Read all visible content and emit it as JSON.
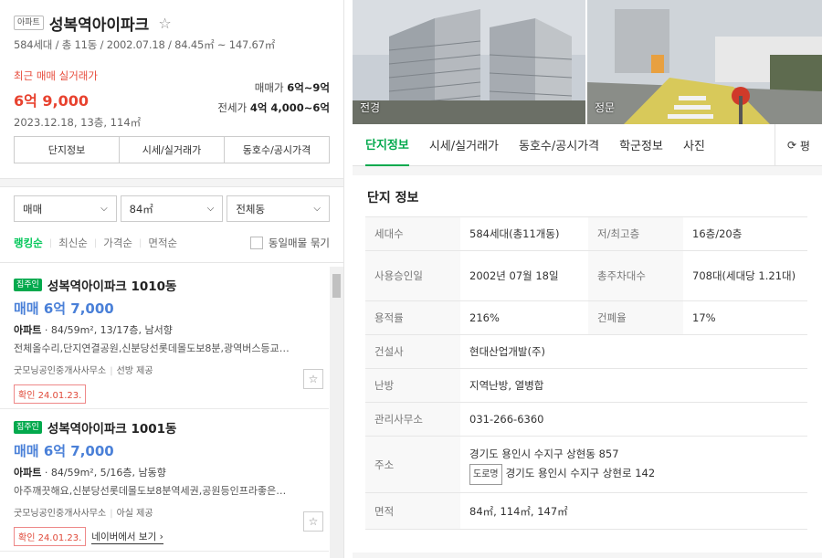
{
  "complex": {
    "type_badge": "아파트",
    "name": "성복역아이파크",
    "meta": "584세대 / 총 11동 / 2002.07.18 / 84.45㎡ ~ 147.67㎡",
    "recent_label": "최근 매매 실거래가",
    "recent_price": "6억 9,000",
    "recent_date": "2023.12.18, 13층, 114㎡",
    "sale_label": "매매가",
    "sale_range": "6억~9억",
    "jeonse_label": "전세가",
    "jeonse_range": "4억 4,000~6억"
  },
  "buttons": {
    "info": "단지정보",
    "price": "시세/실거래가",
    "unit": "동호수/공시가격"
  },
  "filters": {
    "trade": "매매",
    "area": "84㎡",
    "dong": "전체동"
  },
  "sort": {
    "ranking": "랭킹순",
    "latest": "최신순",
    "price": "가격순",
    "area": "면적순",
    "bundle": "동일매물 묶기"
  },
  "listings": [
    {
      "owner": "집주인",
      "name": "성복역아이파크 1010동",
      "price": "매매 6억 7,000",
      "kind": "아파트",
      "spec": " · 84/59m², 13/17층, 남서향",
      "features": "전체올수리,단지연결공원,신분당선롯데몰도보8분,광역버스등교…",
      "agent": "굿모닝공인중개사사무소",
      "provider": "선방 제공",
      "confirm": "확인 24.01.23.",
      "naver": ""
    },
    {
      "owner": "집주인",
      "name": "성복역아이파크 1001동",
      "price": "매매 6억 7,000",
      "kind": "아파트",
      "spec": " · 84/59m², 5/16층, 남동향",
      "features": "아주깨끗해요,신분당선롯데몰도보8분역세권,공원등인프라좋은…",
      "agent": "굿모닝공인중개사사무소",
      "provider": "아실 제공",
      "confirm": "확인 24.01.23.",
      "naver": "네이버에서 보기 ›"
    }
  ],
  "photos": {
    "left_caption": "전경",
    "right_caption": "정문"
  },
  "tabs": [
    "단지정보",
    "시세/실거래가",
    "동호수/공시가격",
    "학군정보",
    "사진"
  ],
  "tab_more": "평",
  "info": {
    "title": "단지 정보",
    "households_k": "세대수",
    "households_v": "584세대(총11개동)",
    "floors_k": "저/최고층",
    "floors_v": "16층/20층",
    "approval_k": "사용승인일",
    "approval_v": "2002년 07월 18일",
    "parking_k": "총주차대수",
    "parking_v": "708대(세대당 1.21대)",
    "far_k": "용적률",
    "far_v": "216%",
    "bcr_k": "건폐율",
    "bcr_v": "17%",
    "builder_k": "건설사",
    "builder_v": "현대산업개발(주)",
    "heating_k": "난방",
    "heating_v": "지역난방, 열병합",
    "office_k": "관리사무소",
    "office_v": "031-266-6360",
    "address_k": "주소",
    "address_v": "경기도 용인시 수지구 상현동 857",
    "road_badge": "도로명",
    "road_v": "경기도 용인시 수지구 상현로 142",
    "area_k": "면적",
    "area_v": "84㎡, 114㎡, 147㎡"
  }
}
